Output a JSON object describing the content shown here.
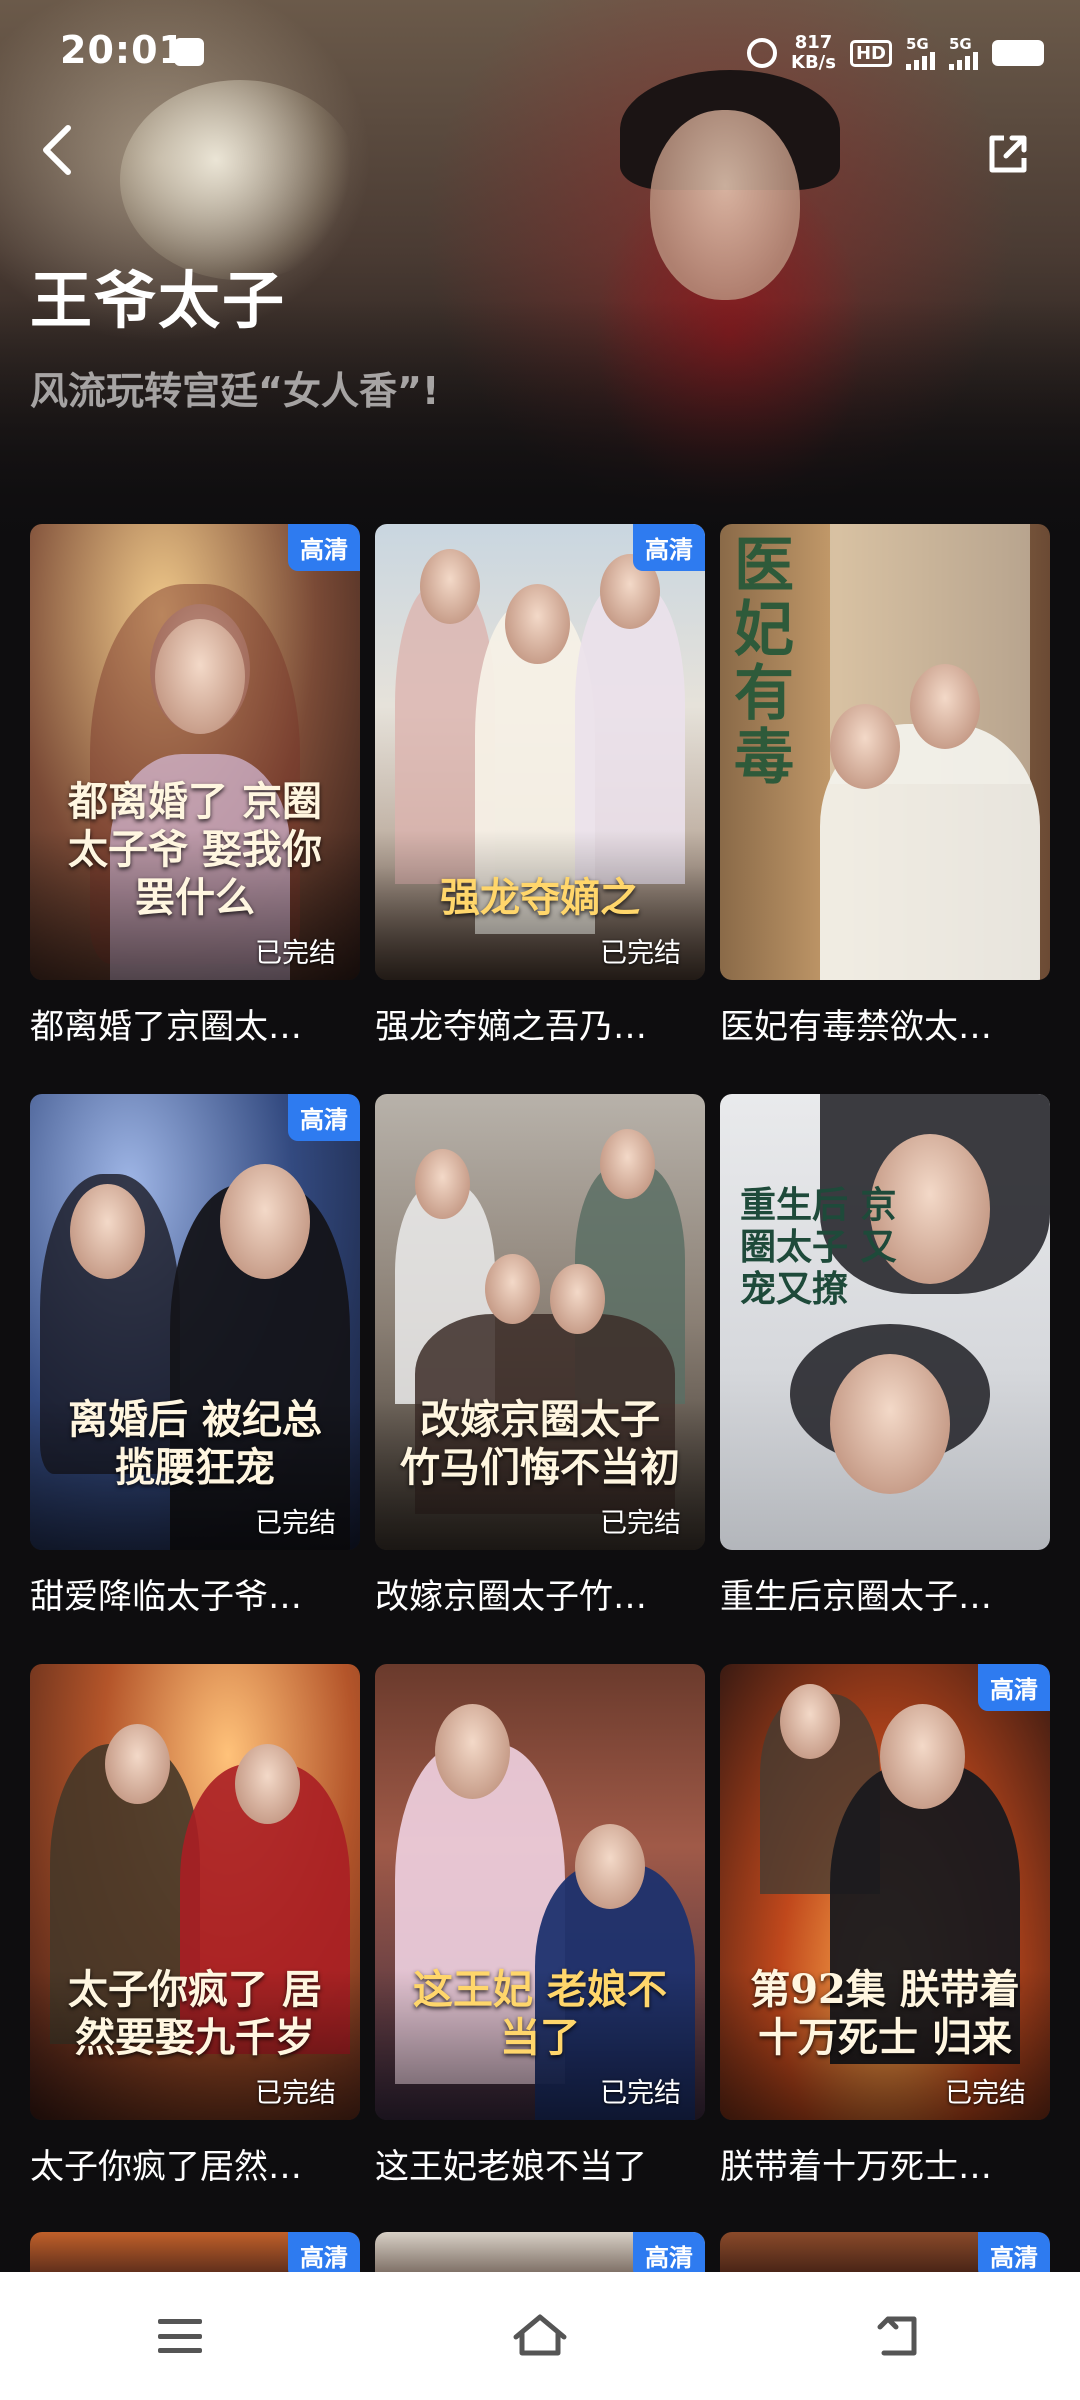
{
  "status_bar": {
    "time": "20:01",
    "net_speed_value": "817",
    "net_speed_unit": "KB/s",
    "hd_label": "HD",
    "sim1_label": "5G",
    "sim2_label": "5G",
    "icons": [
      "notification-icon",
      "alarm-icon",
      "hd-voice-icon",
      "signal-icon",
      "signal-icon",
      "battery-icon"
    ]
  },
  "header": {
    "title": "王爷太子",
    "subtitle": "风流玩转宫廷“女人香”!",
    "back_icon": "chevron-left-icon",
    "share_icon": "share-icon"
  },
  "colors": {
    "background": "#0e0d0f",
    "badge_blue": "#2e7bf0",
    "nav_bar": "#ffffff"
  },
  "cards": [
    {
      "title": "都离婚了京圈太…",
      "poster_text": "都离婚了 京圈太子爷 娶我你罢什么",
      "badge": "高清",
      "status": "已完结"
    },
    {
      "title": "强龙夺嫡之吾乃…",
      "poster_text": "强龙夺嫡之",
      "badge": "高清",
      "status": "已完结"
    },
    {
      "title": "医妃有毒禁欲太…",
      "poster_text": "医妃有毒",
      "badge": "",
      "status": ""
    },
    {
      "title": "甜爱降临太子爷…",
      "poster_text": "离婚后 被纪总揽腰狂宠",
      "badge": "高清",
      "status": "已完结"
    },
    {
      "title": "改嫁京圈太子竹…",
      "poster_text": "改嫁京圈太子 竹马们悔不当初",
      "badge": "",
      "status": "已完结"
    },
    {
      "title": "重生后京圈太子…",
      "poster_text": "重生后 京圈太子 又宠又撩",
      "badge": "",
      "status": ""
    },
    {
      "title": "太子你疯了居然…",
      "poster_text": "太子你疯了 居然要娶九千岁",
      "badge": "",
      "status": "已完结"
    },
    {
      "title": "这王妃老娘不当了",
      "poster_text": "这王妃 老娘不当了",
      "badge": "",
      "status": "已完结"
    },
    {
      "title": "朕带着十万死士…",
      "poster_text": "第92集 朕带着十万死士 归来",
      "badge": "高清",
      "status": "已完结"
    }
  ],
  "next_row_badges": [
    "高清",
    "高清",
    "高清"
  ],
  "bottom_nav": {
    "icons": [
      "menu-icon",
      "home-icon",
      "back-icon"
    ]
  }
}
